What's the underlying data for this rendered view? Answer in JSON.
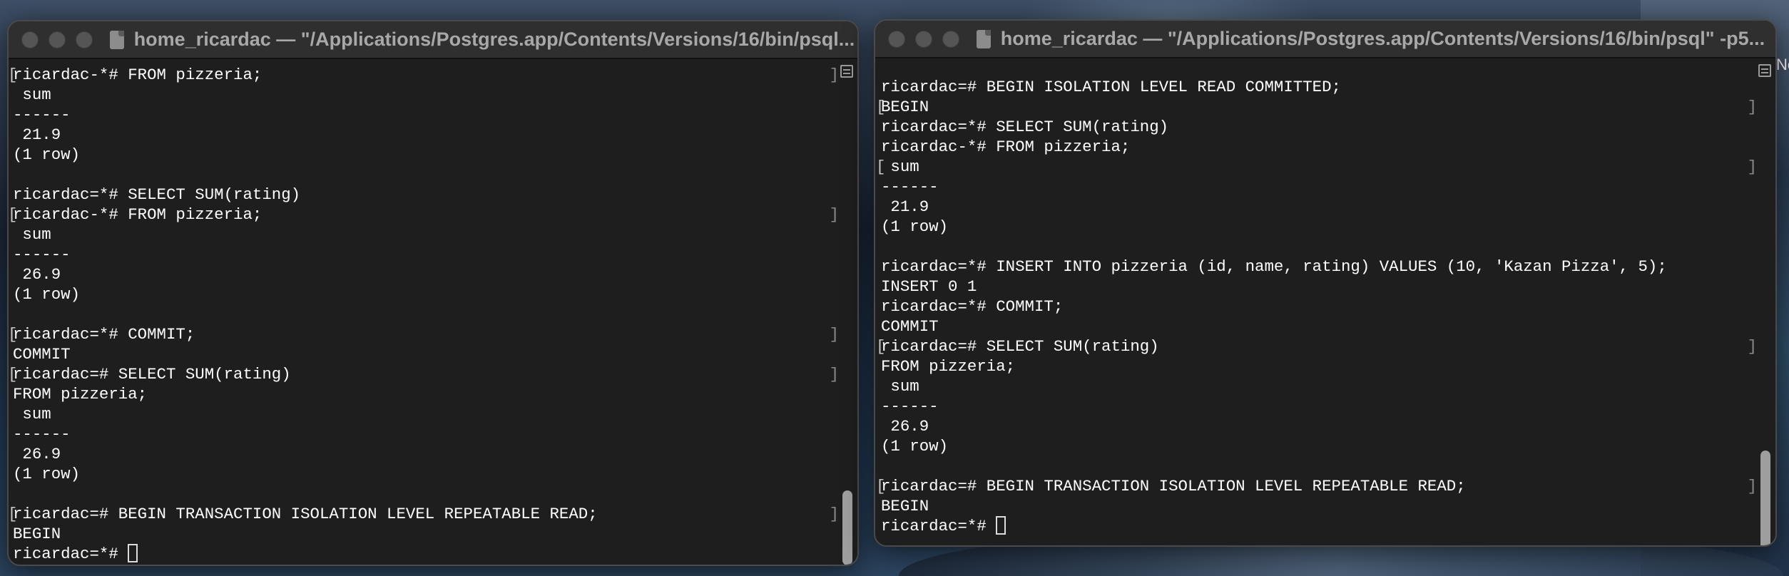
{
  "left_window": {
    "title": "home_ricardac — \"/Applications/Postgres.app/Contents/Versions/16/bin/psql...",
    "lines": [
      {
        "text": "ricardac-*# FROM pizzeria;",
        "marked": true
      },
      {
        "text": " sum",
        "marked": false
      },
      {
        "text": "------",
        "marked": false
      },
      {
        "text": " 21.9",
        "marked": false
      },
      {
        "text": "(1 row)",
        "marked": false
      },
      {
        "text": "",
        "marked": false
      },
      {
        "text": "ricardac=*# SELECT SUM(rating)",
        "marked": false
      },
      {
        "text": "ricardac-*# FROM pizzeria;",
        "marked": true
      },
      {
        "text": " sum",
        "marked": false
      },
      {
        "text": "------",
        "marked": false
      },
      {
        "text": " 26.9",
        "marked": false
      },
      {
        "text": "(1 row)",
        "marked": false
      },
      {
        "text": "",
        "marked": false
      },
      {
        "text": "ricardac=*# COMMIT;",
        "marked": true
      },
      {
        "text": "COMMIT",
        "marked": false
      },
      {
        "text": "ricardac=# SELECT SUM(rating)",
        "marked": true
      },
      {
        "text": "FROM pizzeria;",
        "marked": false
      },
      {
        "text": " sum",
        "marked": false
      },
      {
        "text": "------",
        "marked": false
      },
      {
        "text": " 26.9",
        "marked": false
      },
      {
        "text": "(1 row)",
        "marked": false
      },
      {
        "text": "",
        "marked": false
      },
      {
        "text": "ricardac=# BEGIN TRANSACTION ISOLATION LEVEL REPEATABLE READ;",
        "marked": true
      },
      {
        "text": "BEGIN",
        "marked": false
      }
    ],
    "prompt": "ricardac=*# "
  },
  "right_window": {
    "title": "home_ricardac — \"/Applications/Postgres.app/Contents/Versions/16/bin/psql\" -p5...",
    "lines": [
      {
        "text": "ricardac=# BEGIN ISOLATION LEVEL READ COMMITTED;",
        "marked": false
      },
      {
        "text": "BEGIN",
        "marked": true
      },
      {
        "text": "ricardac=*# SELECT SUM(rating)",
        "marked": false
      },
      {
        "text": "ricardac-*# FROM pizzeria;",
        "marked": false
      },
      {
        "text": " sum",
        "marked": true
      },
      {
        "text": "------",
        "marked": false
      },
      {
        "text": " 21.9",
        "marked": false
      },
      {
        "text": "(1 row)",
        "marked": false
      },
      {
        "text": "",
        "marked": false
      },
      {
        "text": "ricardac=*# INSERT INTO pizzeria (id, name, rating) VALUES (10, 'Kazan Pizza', 5);",
        "marked": false
      },
      {
        "text": "INSERT 0 1",
        "marked": false
      },
      {
        "text": "ricardac=*# COMMIT;",
        "marked": false
      },
      {
        "text": "COMMIT",
        "marked": false
      },
      {
        "text": "ricardac=# SELECT SUM(rating)",
        "marked": true
      },
      {
        "text": "FROM pizzeria;",
        "marked": false
      },
      {
        "text": " sum",
        "marked": false
      },
      {
        "text": "------",
        "marked": false
      },
      {
        "text": " 26.9",
        "marked": false
      },
      {
        "text": "(1 row)",
        "marked": false
      },
      {
        "text": "",
        "marked": false
      },
      {
        "text": "ricardac=# BEGIN TRANSACTION ISOLATION LEVEL REPEATABLE READ;",
        "marked": true
      },
      {
        "text": "BEGIN",
        "marked": false
      }
    ],
    "prompt": "ricardac=*# "
  },
  "desktop_edge_text": "Ne"
}
